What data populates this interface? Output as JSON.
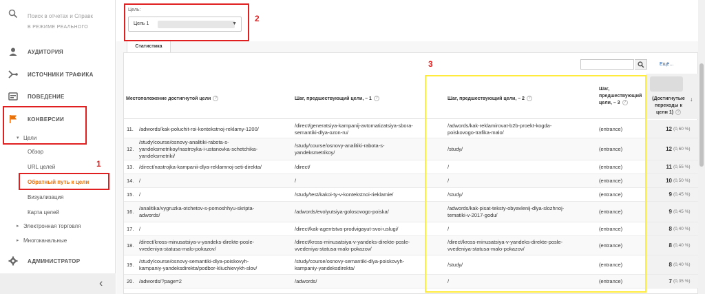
{
  "sidebar": {
    "search_placeholder": "Поиск в отчетах и Справк",
    "search_under_text": "В РЕЖИМЕ РЕАЛЬНОГО",
    "nav": [
      {
        "label": "АУДИТОРИЯ",
        "icon": "person-icon"
      },
      {
        "label": "ИСТОЧНИКИ ТРАФИКА",
        "icon": "acquisition-icon"
      },
      {
        "label": "ПОВЕДЕНИЕ",
        "icon": "behavior-icon"
      },
      {
        "label": "КОНВЕРСИИ",
        "icon": "flag-icon"
      }
    ],
    "goals_label": "Цели",
    "goals_sub": [
      "Обзор",
      "URL целей",
      "Обратный путь к цели",
      "Визуализация",
      "Карта целей"
    ],
    "ecommerce": "Электронная торговля",
    "multichannel": "Многоканальные",
    "admin": "АДМИНИСТРАТОР",
    "collapse": "‹"
  },
  "goal_picker": {
    "label": "Цель:",
    "value": "Цель 1"
  },
  "tab_label": "Статистика",
  "table_search": {
    "placeholder": "",
    "more": "Ещё..."
  },
  "columns": {
    "c0": "Местоположение достигнутой цели",
    "c1": "Шаг, предшествующий цели, – 1",
    "c2": "Шаг, предшествующий цели, – 2",
    "c3a": "Шаг,",
    "c3b": "предшествующий",
    "c3c": "цели, – 3",
    "c4a": "(Достигнутые",
    "c4b": "переходы к",
    "c4c": "цели 1)"
  },
  "rows": [
    {
      "n": "11.",
      "c0": [
        "/adwords/kak-poluchit-roi-kontekstnoj-reklamy-1200/"
      ],
      "c1": [
        "/direct/generatsiya-kampanij-avtomatizatsiya-sbora-",
        "semantiki-dlya-ozon-ru/"
      ],
      "c2": [
        "/adwords/kak-reklamirovat-b2b-proekt-kogda-",
        "poiskovogo-trafika-malo/"
      ],
      "c3": "(entrance)",
      "val": "12",
      "pct": "(0,60 %)"
    },
    {
      "n": "12.",
      "c0": [
        "/study/course/osnovy-analitiki-rabota-s-",
        "yandeksmetrikoy/nastroyka-i-ustanovka-schetchika-",
        "yandeksmetriki/"
      ],
      "c1": [
        "/study/course/osnovy-analitiki-rabota-s-",
        "yandeksmetrikoy/"
      ],
      "c2": [
        "/study/"
      ],
      "c3": "(entrance)",
      "val": "12",
      "pct": "(0,60 %)"
    },
    {
      "n": "13.",
      "c0": [
        "/direct/nastrojka-kampanii-dlya-reklamnoj-seti-direkta/"
      ],
      "c1": [
        "/direct/"
      ],
      "c2": [
        "/"
      ],
      "c3": "(entrance)",
      "val": "11",
      "pct": "(0,55 %)"
    },
    {
      "n": "14.",
      "c0": [
        "/"
      ],
      "c1": [
        "/"
      ],
      "c2": [
        "/"
      ],
      "c3": "(entrance)",
      "val": "10",
      "pct": "(0,50 %)"
    },
    {
      "n": "15.",
      "c0": [
        "/"
      ],
      "c1": [
        "/study/test/kakoi-ty-v-kontekstnoi-rieklamie/"
      ],
      "c2": [
        "/study/"
      ],
      "c3": "(entrance)",
      "val": "9",
      "pct": "(0,45 %)"
    },
    {
      "n": "16.",
      "c0": [
        "/analitika/vygruzka-otchetov-s-pomoshhyu-skripta-",
        "adwords/"
      ],
      "c1": [
        "/adwords/evolyutsiya-golosovogo-poiska/"
      ],
      "c2": [
        "/adwords/kak-pisat-teksty-obyavlenij-dlya-slozhnoj-",
        "tematiki-v-2017-godu/"
      ],
      "c3": "(entrance)",
      "val": "9",
      "pct": "(0,45 %)"
    },
    {
      "n": "17.",
      "c0": [
        "/"
      ],
      "c1": [
        "/direct/kak-agentstva-prodvigayut-svoi-uslugi/"
      ],
      "c2": [
        "/"
      ],
      "c3": "(entrance)",
      "val": "8",
      "pct": "(0,40 %)"
    },
    {
      "n": "18.",
      "c0": [
        "/direct/kross-minusatsiya-v-yandeks-direkte-posle-",
        "vvedeniya-statusa-malo-pokazov/"
      ],
      "c1": [
        "/direct/kross-minusatsiya-v-yandeks-direkte-posle-",
        "vvedeniya-statusa-malo-pokazov/"
      ],
      "c2": [
        "/direct/kross-minusatsiya-v-yandeks-direkte-posle-",
        "vvedeniya-statusa-malo-pokazov/"
      ],
      "c3": "(entrance)",
      "val": "8",
      "pct": "(0,40 %)"
    },
    {
      "n": "19.",
      "c0": [
        "/study/course/osnovy-semantiki-dlya-poiskovyh-",
        "kampaniy-yandeksdirekta/podbor-kliuchievykh-slov/"
      ],
      "c1": [
        "/study/course/osnovy-semantiki-dlya-poiskovyh-",
        "kampaniy-yandeksdirekta/"
      ],
      "c2": [
        "/study/"
      ],
      "c3": "(entrance)",
      "val": "8",
      "pct": "(0,40 %)"
    },
    {
      "n": "20.",
      "c0": [
        "/adwords/?page=2"
      ],
      "c1": [
        "/adwords/"
      ],
      "c2": [
        "/"
      ],
      "c3": "(entrance)",
      "val": "7",
      "pct": "(0,35 %)"
    }
  ],
  "annotations": {
    "a1": "1",
    "a2": "2",
    "a3": "3"
  },
  "colors": {
    "accent": "#e8710a",
    "annotation_red": "#e02020",
    "annotation_yellow": "#ffeb3b",
    "link": "#1565c0"
  }
}
